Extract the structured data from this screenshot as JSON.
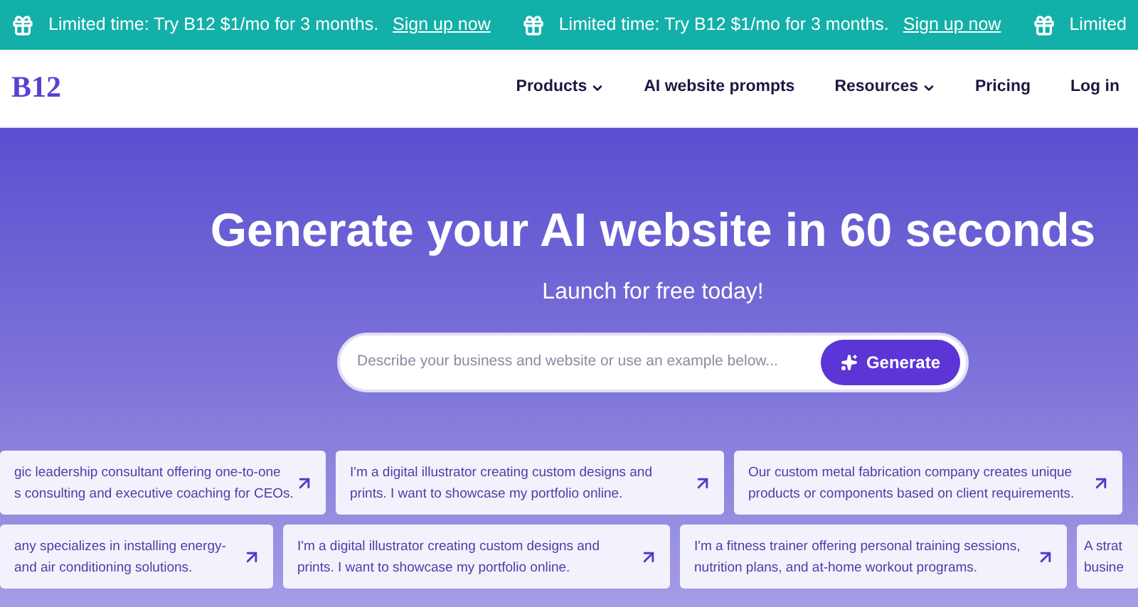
{
  "banner": [
    {
      "text": "Limited time: Try B12 $1/mo for 3 months.",
      "link": "Sign up now"
    },
    {
      "text": "Limited time: Try B12 $1/mo for 3 months.",
      "link": "Sign up now"
    },
    {
      "text": "Limited"
    }
  ],
  "logo": "B12",
  "nav": [
    {
      "label": "Products",
      "dropdown": true
    },
    {
      "label": "AI website prompts",
      "dropdown": false
    },
    {
      "label": "Resources",
      "dropdown": true
    },
    {
      "label": "Pricing",
      "dropdown": false
    },
    {
      "label": "Log in",
      "dropdown": false
    }
  ],
  "hero": {
    "title": "Generate your AI website in 60 seconds",
    "subtitle": "Launch for free today!",
    "placeholder": "Describe your business and website or use an example below...",
    "button": "Generate"
  },
  "prompt_rows": [
    [
      {
        "lines": [
          "gic leadership consultant offering one-to-one",
          "s consulting and executive coaching for CEOs."
        ]
      },
      {
        "lines": [
          "I'm a digital illustrator creating custom designs and",
          "prints. I want to showcase my portfolio online."
        ]
      },
      {
        "lines": [
          "Our custom metal fabrication company creates unique",
          "products or components based on client requirements."
        ]
      }
    ],
    [
      {
        "lines": [
          "any specializes in installing energy-",
          "and air conditioning solutions."
        ]
      },
      {
        "lines": [
          "I'm a digital illustrator creating custom designs and",
          "prints. I want to showcase my portfolio online."
        ]
      },
      {
        "lines": [
          "I'm a fitness trainer offering personal training sessions,",
          "nutrition plans, and at-home workout programs."
        ]
      },
      {
        "lines": [
          "A strat",
          "busine"
        ]
      }
    ]
  ]
}
